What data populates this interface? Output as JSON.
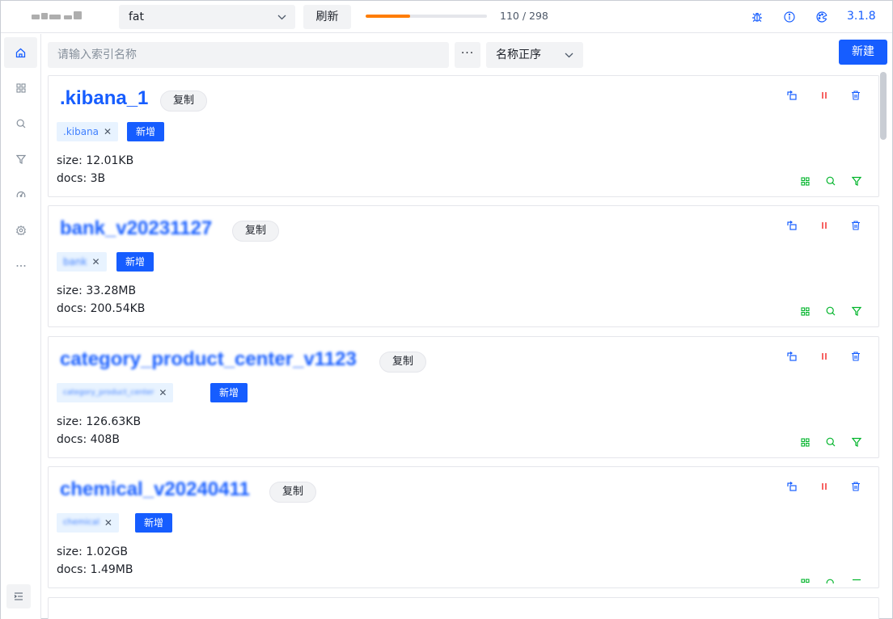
{
  "header": {
    "env_value": "fat",
    "refresh_label": "刷新",
    "progress": {
      "current": 110,
      "total": 298,
      "text": "110 / 298"
    },
    "version": "3.1.8",
    "icons": [
      "bug-icon",
      "info-icon",
      "palette-icon"
    ]
  },
  "sidebar": {
    "items": [
      "home-icon",
      "grid-icon",
      "search-icon",
      "filter-icon",
      "dashboard-icon",
      "settings-icon",
      "more-icon"
    ],
    "collapse_icon": "menu-fold-icon"
  },
  "toolbar": {
    "search_placeholder": "请输入索引名称",
    "more_label": "···",
    "sort_value": "名称正序",
    "new_label": "新建"
  },
  "indices": [
    {
      "name": ".kibana_1",
      "copy_label": "复制",
      "alias": ".kibana",
      "add_label": "新增",
      "size": "size: 12.01KB",
      "docs": "docs: 3B"
    },
    {
      "name": "bank_v20231127",
      "copy_label": "复制",
      "alias": "bank",
      "add_label": "新增",
      "size": "size: 33.28MB",
      "docs": "docs: 200.54KB"
    },
    {
      "name": "category_product_center_v1123",
      "copy_label": "复制",
      "alias": "category_product_center",
      "add_label": "新增",
      "size": "size: 126.63KB",
      "docs": "docs: 408B"
    },
    {
      "name": "chemical_v20240411",
      "copy_label": "复制",
      "alias": "chemical",
      "add_label": "新增",
      "size": "size: 1.02GB",
      "docs": "docs: 1.49MB"
    }
  ],
  "colors": {
    "primary": "#165dff",
    "danger": "#f53f3f",
    "success": "#00b42a",
    "progress": "#ff7d00"
  }
}
